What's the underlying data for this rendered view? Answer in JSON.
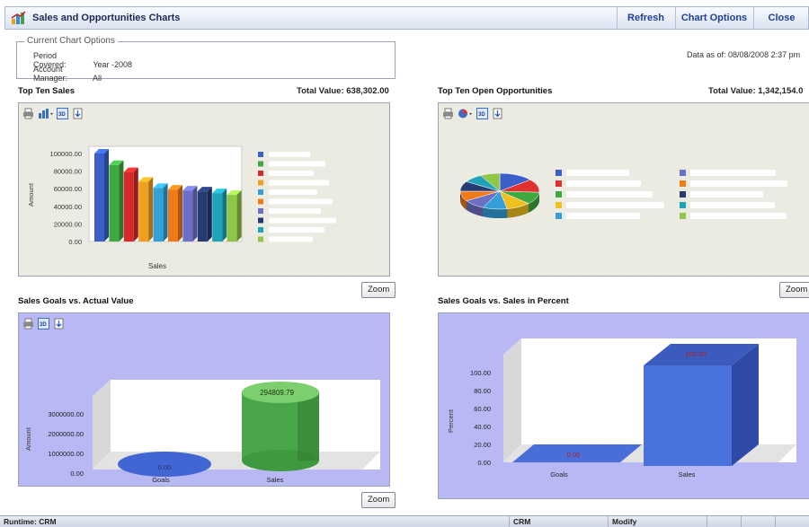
{
  "window": {
    "title": "Sales and Opportunities Charts",
    "refresh_label": "Refresh",
    "chart_options_label": "Chart Options",
    "close_label": "Close"
  },
  "chart_options": {
    "legend": "Current Chart Options",
    "period_label": "Period Covered:",
    "period_value": "Year -2008",
    "manager_label": "Account Manager:",
    "manager_value": "All",
    "date_as_of": "Data as of: 08/08/2008 2:37 pm"
  },
  "panels": {
    "top_sales": {
      "title": "Top Ten Sales",
      "total": "Total Value: 638,302.00",
      "zoom": "Zoom"
    },
    "top_opps": {
      "title": "Top Ten Open Opportunities",
      "total": "Total Value: 1,342,154.0",
      "zoom": "Zoom"
    },
    "goals_actual": {
      "title": "Sales Goals vs. Actual Value",
      "zoom": "Zoom"
    },
    "goals_percent": {
      "title": "Sales Goals vs. Sales in Percent"
    }
  },
  "colors": {
    "bar_series": [
      "#3a5fc8",
      "#3fa83f",
      "#d62a2a",
      "#f0a020",
      "#35a0d8",
      "#ee7a18",
      "#6c6fc6",
      "#273b73",
      "#1ea3b8",
      "#90c648"
    ],
    "pie_series": [
      "#3a5fc8",
      "#e03030",
      "#3fa83f",
      "#f0c020",
      "#35a0d8",
      "#6c6fc6",
      "#ee7a18",
      "#273b73",
      "#1ea3b8",
      "#90c648"
    ],
    "goal_panel_bg": "#b8b8f4",
    "opts_panel_bg": "#ecebe2"
  },
  "chart_data": [
    {
      "type": "bar",
      "title": "Top Ten Sales",
      "xlabel": "Sales",
      "ylabel": "Amount",
      "ylim": [
        0,
        100000
      ],
      "yticks": [
        "100000.00",
        "80000.00",
        "60000.00",
        "40000.00",
        "20000.00",
        "0.00"
      ],
      "values": [
        100000,
        87000,
        79000,
        68000,
        61000,
        59000,
        58000,
        57000,
        55000,
        53000
      ]
    },
    {
      "type": "pie",
      "title": "Top Ten Open Opportunities",
      "values": [
        14,
        12,
        11,
        10,
        10,
        9,
        9,
        9,
        8,
        8
      ]
    },
    {
      "type": "bar",
      "title": "Sales Goals vs. Actual Value",
      "ylabel": "Amount",
      "categories": [
        "Goals",
        "Sales"
      ],
      "values": [
        0,
        294809.79
      ],
      "value_labels": [
        "0.00",
        "294809.79"
      ],
      "yticks": [
        "3000000.00",
        "2000000.00",
        "1000000.00",
        "0.00"
      ]
    },
    {
      "type": "bar",
      "title": "Sales Goals vs. Sales in Percent",
      "ylabel": "Percent",
      "categories": [
        "Goals",
        "Sales"
      ],
      "values": [
        0,
        100
      ],
      "value_labels": [
        "0.00",
        "100.00"
      ],
      "ylim": [
        0,
        100
      ],
      "yticks": [
        "100.00",
        "80.00",
        "60.00",
        "40.00",
        "20.00",
        "0.00"
      ]
    }
  ],
  "statusbar": {
    "runtime": "Runtime: CRM",
    "module": "CRM",
    "mode": "Modify"
  }
}
